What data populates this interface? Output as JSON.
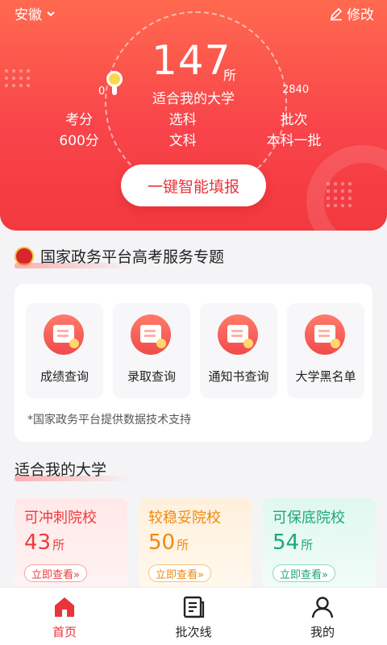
{
  "header": {
    "province": "安徽",
    "edit_label": "修改",
    "count": "147",
    "count_unit": "所",
    "count_label": "适合我的大学",
    "range_min": "0",
    "range_max": "2840",
    "stats": [
      {
        "label": "考分",
        "value": "600分"
      },
      {
        "label": "选科",
        "value": "文科"
      },
      {
        "label": "批次",
        "value": "本科一批"
      }
    ],
    "cta_label": "一键智能填报"
  },
  "gov_section": {
    "title": "国家政务平台高考服务专题",
    "services": [
      {
        "label": "成绩查询"
      },
      {
        "label": "录取查询"
      },
      {
        "label": "通知书查询"
      },
      {
        "label": "大学黑名单"
      }
    ],
    "note": "*国家政务平台提供数据技术支持"
  },
  "uni_section": {
    "title": "适合我的大学",
    "cards": [
      {
        "title": "可冲刺院校",
        "count": "43",
        "unit": "所",
        "button": "立即查看»"
      },
      {
        "title": "较稳妥院校",
        "count": "50",
        "unit": "所",
        "button": "立即查看»"
      },
      {
        "title": "可保底院校",
        "count": "54",
        "unit": "所",
        "button": "立即查看»"
      }
    ]
  },
  "tabs": [
    {
      "label": "首页",
      "icon": "home-icon",
      "active": true
    },
    {
      "label": "批次线",
      "icon": "document-icon",
      "active": false
    },
    {
      "label": "我的",
      "icon": "user-icon",
      "active": false
    }
  ],
  "colors": {
    "brand_red": "#f2393f",
    "orange": "#ee8a12",
    "green": "#1ca77a"
  }
}
